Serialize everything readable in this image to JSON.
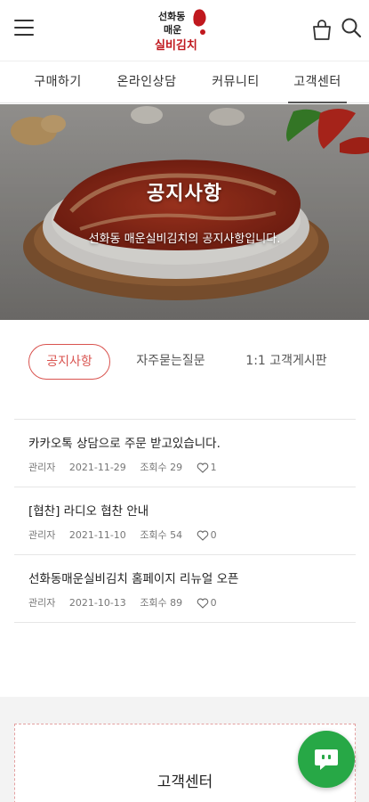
{
  "header": {
    "logo_alt": "선화동 매운 실비김치",
    "logo_line1": "선화동",
    "logo_line2": "매운",
    "logo_line3": "실비김치"
  },
  "nav": {
    "items": [
      {
        "label": "구매하기"
      },
      {
        "label": "온라인상담"
      },
      {
        "label": "커뮤니티"
      },
      {
        "label": "고객센터",
        "active": true
      }
    ]
  },
  "hero": {
    "title": "공지사항",
    "subtitle": "선화동 매운실비김치의 공지사항입니다."
  },
  "subtabs": [
    {
      "label": "공지사항",
      "active": true
    },
    {
      "label": "자주묻는질문"
    },
    {
      "label": "1:1 고객게시판"
    }
  ],
  "posts": [
    {
      "title": "카카오톡 상담으로 주문 받고있습니다.",
      "author": "관리자",
      "date": "2021-11-29",
      "views": "조회수 29",
      "likes": "1"
    },
    {
      "title": "[협찬] 라디오 협찬 안내",
      "author": "관리자",
      "date": "2021-11-10",
      "views": "조회수 54",
      "likes": "0"
    },
    {
      "title": "선화동매운실비김치 홈페이지 리뉴얼 오픈",
      "author": "관리자",
      "date": "2021-10-13",
      "views": "조회수 89",
      "likes": "0"
    }
  ],
  "footer": {
    "cs_title": "고객센터"
  },
  "colors": {
    "accent": "#d9534f",
    "chat": "#27a846"
  },
  "icons": {
    "menu": "hamburger-icon",
    "bag": "shopping-bag-icon",
    "search": "search-icon",
    "like": "heart-icon",
    "chat": "chat-bubble-icon"
  }
}
